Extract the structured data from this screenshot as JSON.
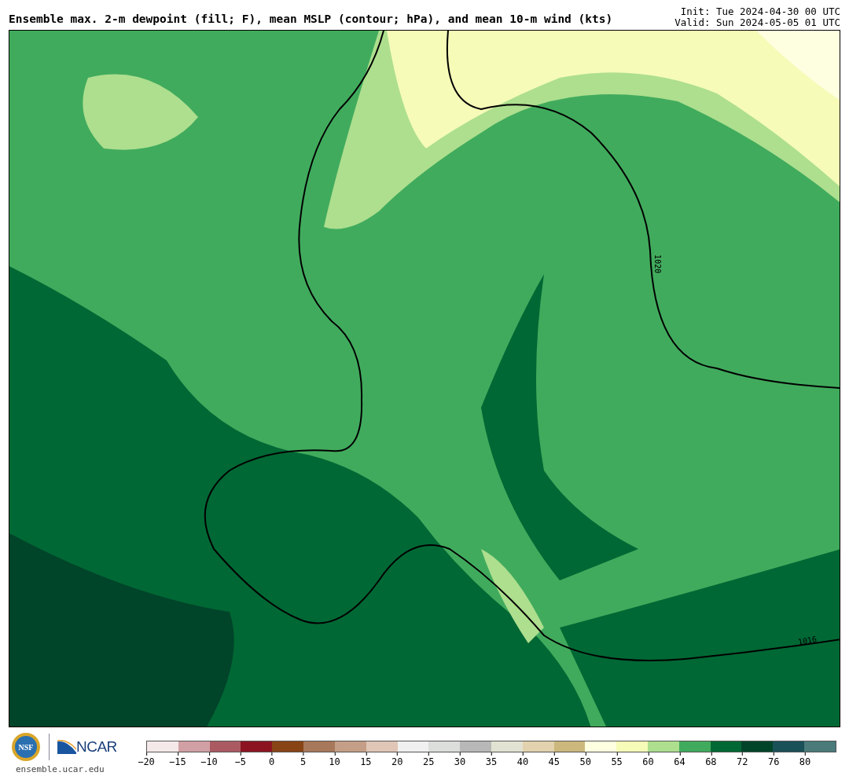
{
  "title": "Ensemble max. 2-m dewpoint (fill; F), mean MSLP (contour; hPa), and mean 10-m wind (kts)",
  "init": "Init: Tue 2024-04-30 00 UTC",
  "valid": "Valid: Sun 2024-05-05 01 UTC",
  "map": {
    "contour_labels": [
      "1020",
      "1016"
    ]
  },
  "footer": {
    "nsf_logo": "NSF",
    "ncar_logo": "NCAR",
    "site": "ensemble.ucar.edu"
  },
  "colorbar": {
    "segments": [
      {
        "color": "#f4e8e8"
      },
      {
        "color": "#d1a0a4"
      },
      {
        "color": "#ab5a62"
      },
      {
        "color": "#8b1420"
      },
      {
        "color": "#884414"
      },
      {
        "color": "#a8785a"
      },
      {
        "color": "#c49e86"
      },
      {
        "color": "#e0c6b6"
      },
      {
        "color": "#f0f0f0"
      },
      {
        "color": "#dcdedc"
      },
      {
        "color": "#b8b8b8"
      },
      {
        "color": "#e2e2d2"
      },
      {
        "color": "#e2d2ae"
      },
      {
        "color": "#ccb87c"
      },
      {
        "color": "#fefee0"
      },
      {
        "color": "#f6fbb8"
      },
      {
        "color": "#addf8e"
      },
      {
        "color": "#41ab5d"
      },
      {
        "color": "#006834"
      },
      {
        "color": "#00442a"
      },
      {
        "color": "#1a5058"
      },
      {
        "color": "#4a7a7a"
      }
    ],
    "ticks": [
      "−20",
      "−15",
      "−10",
      "−5",
      "0",
      "5",
      "10",
      "15",
      "20",
      "25",
      "30",
      "35",
      "40",
      "45",
      "50",
      "55",
      "60",
      "64",
      "68",
      "72",
      "76",
      "80"
    ]
  }
}
